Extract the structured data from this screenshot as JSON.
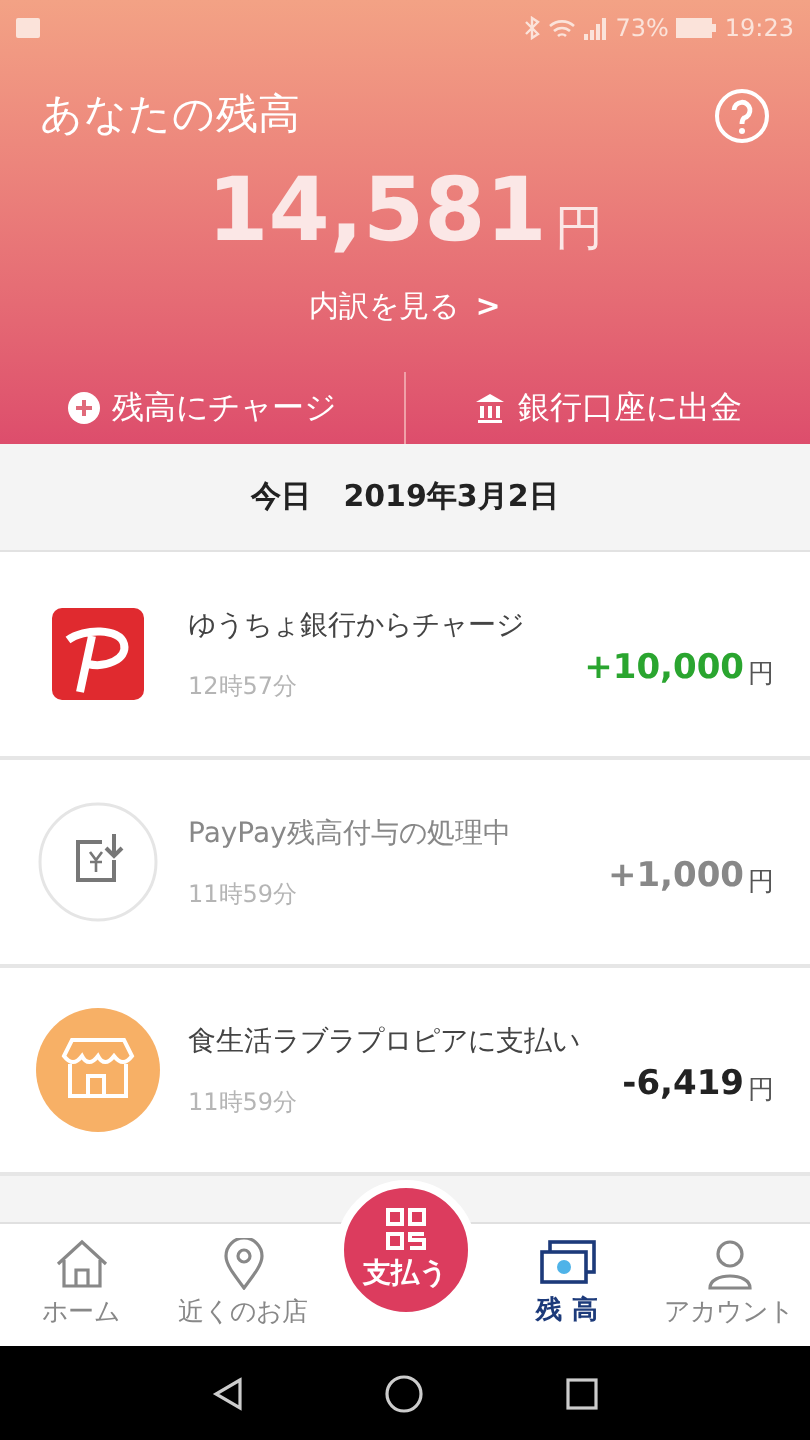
{
  "status_bar": {
    "battery": "73%",
    "time": "19:23"
  },
  "header": {
    "title": "あなたの残高",
    "amount": "14,581",
    "currency": "円",
    "breakdown_link": "内訳を見る",
    "breakdown_arrow": ">",
    "actions": [
      {
        "kind": "charge",
        "label": "残高にチャージ"
      },
      {
        "kind": "bank",
        "label": "銀行口座に出金"
      }
    ]
  },
  "date_header": {
    "label": "今日",
    "date": "2019年3月2日"
  },
  "transactions": [
    {
      "kind": "charge",
      "title": "ゆうちょ銀行からチャージ",
      "time": "12時57分",
      "amount": "+10,000",
      "currency": "円"
    },
    {
      "kind": "pending",
      "title": "PayPay残高付与の処理中",
      "time": "11時59分",
      "amount": "+1,000",
      "currency": "円"
    },
    {
      "kind": "payment",
      "title": "食生活ラブラプロピアに支払い",
      "time": "11時59分",
      "amount": "-6,419",
      "currency": "円"
    }
  ],
  "bottom_nav": [
    {
      "kind": "home",
      "label": "ホーム",
      "selected": false
    },
    {
      "kind": "map",
      "label": "近くのお店",
      "selected": false
    },
    {
      "kind": "pay",
      "label": "支払う",
      "selected": false
    },
    {
      "kind": "balance",
      "label": "残 高",
      "selected": true
    },
    {
      "kind": "account",
      "label": "アカウント",
      "selected": false
    }
  ]
}
